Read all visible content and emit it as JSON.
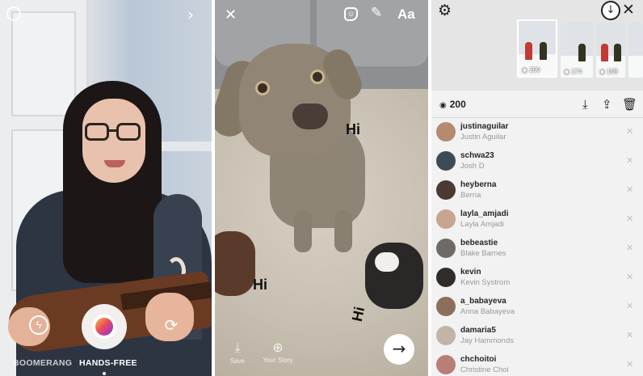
{
  "camera": {
    "modes": [
      "BOOMERANG",
      "HANDS-FREE"
    ],
    "icons": [
      "camera-ring-icon",
      "chevron-right-icon",
      "flash-icon",
      "shutter",
      "flip-camera-icon"
    ]
  },
  "editor": {
    "text_tool": "Aa",
    "stickers": [
      "Hi",
      "Hi",
      "Hi"
    ],
    "actions": {
      "save": "Save",
      "your_story": "Your Story"
    },
    "icons": [
      "close-icon",
      "sticker-icon",
      "pen-icon",
      "next-arrow-icon"
    ]
  },
  "viewers": {
    "thumb_counts": [
      "200",
      "174",
      "168"
    ],
    "view_count": "200",
    "list": [
      {
        "username": "justinaguilar",
        "name": "Justin Aguilar",
        "avatar_color": "#b58a70"
      },
      {
        "username": "schwa23",
        "name": "Josh D",
        "avatar_color": "#3e4a55"
      },
      {
        "username": "heyberna",
        "name": "Berna",
        "avatar_color": "#4a3a34"
      },
      {
        "username": "layla_amjadi",
        "name": "Layla Amjadi",
        "avatar_color": "#c9a48e"
      },
      {
        "username": "bebeastie",
        "name": "Blake Barnes",
        "avatar_color": "#6e6a66"
      },
      {
        "username": "kevin",
        "name": "Kevin Systrom",
        "avatar_color": "#2f2c2a"
      },
      {
        "username": "a_babayeva",
        "name": "Anna Babayeva",
        "avatar_color": "#8d6e5c"
      },
      {
        "username": "damaria5",
        "name": "Jay Hammonds",
        "avatar_color": "#c2b4a6"
      },
      {
        "username": "chchoitoi",
        "name": "Christine Choi",
        "avatar_color": "#b77f76"
      }
    ]
  }
}
